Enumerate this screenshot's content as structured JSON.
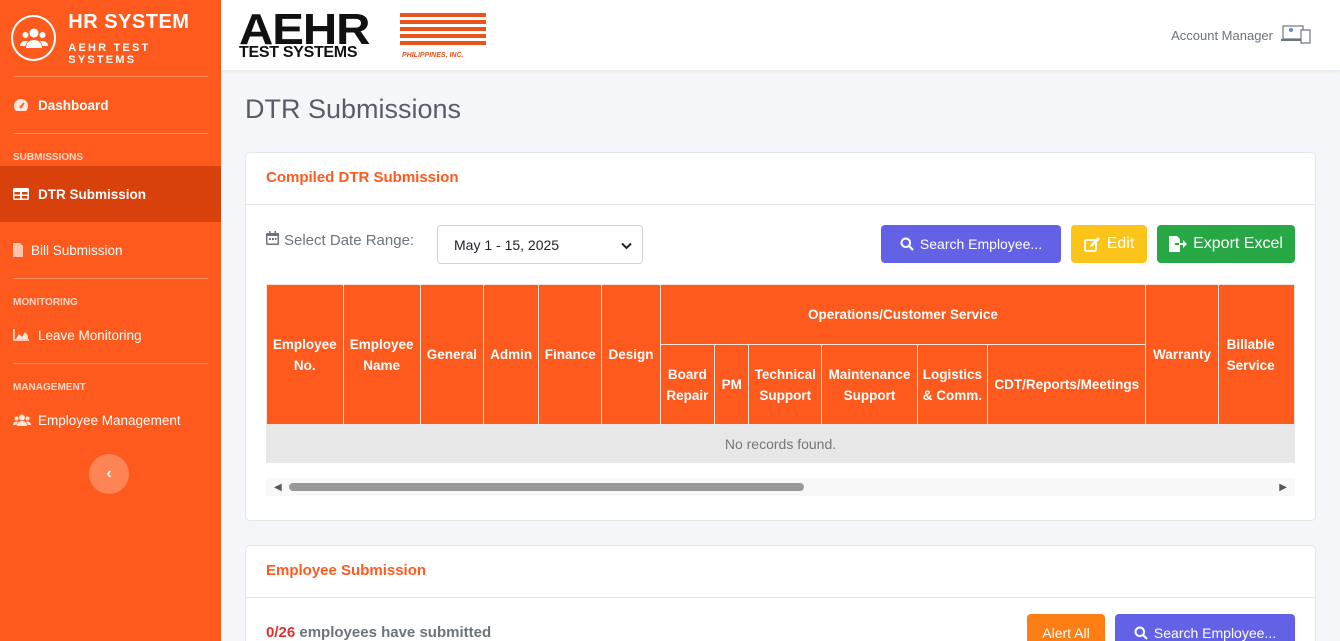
{
  "sidebar": {
    "brand_title": "HR SYSTEM",
    "brand_subtitle": "AEHR TEST SYSTEMS",
    "dashboard": "Dashboard",
    "section_submissions": "SUBMISSIONS",
    "dtr_submission": "DTR Submission",
    "bill_submission": "Bill Submission",
    "section_monitoring": "MONITORING",
    "leave_monitoring": "Leave Monitoring",
    "section_management": "MANAGEMENT",
    "employee_management": "Employee Management",
    "collapse_glyph": "‹"
  },
  "topbar": {
    "logo_main": "AEHR",
    "logo_sub": "TEST SYSTEMS",
    "logo_ph": "PHILIPPINES, INC.",
    "account": "Account Manager"
  },
  "page": {
    "title": "DTR Submissions"
  },
  "compiled": {
    "title": "Compiled DTR Submission",
    "date_label": "Select Date Range:",
    "date_value": "May 1 - 15, 2025",
    "search_button": "Search Employee...",
    "edit_button": "Edit",
    "export_button": "Export Excel",
    "table": {
      "col_emp_no": "Employee No.",
      "col_emp_name": "Employee Name",
      "col_general": "General",
      "col_admin": "Admin",
      "col_finance": "Finance",
      "col_design": "Design",
      "group_ops": "Operations/Customer Service",
      "col_board_repair": "Board Repair",
      "col_pm": "PM",
      "col_tech_support": "Technical Support",
      "col_maint_support": "Maintenance Support",
      "col_logistics": "Logistics & Comm.",
      "col_cdt": "CDT/Reports/Meetings",
      "col_warranty": "Warranty",
      "col_billable": "Billable Service"
    },
    "empty_text": "No records found."
  },
  "employee_submission": {
    "title": "Employee Submission",
    "count": "0/26",
    "count_suffix": "employees have submitted",
    "alert_button": "Alert All",
    "search_button": "Search Employee..."
  },
  "colors": {
    "primary": "#fe5a1d",
    "active_nav": "#d8400c",
    "search_btn": "#6362e7",
    "edit_btn": "#fcc419",
    "export_btn": "#28a745",
    "alert_btn": "#fd7e14"
  }
}
